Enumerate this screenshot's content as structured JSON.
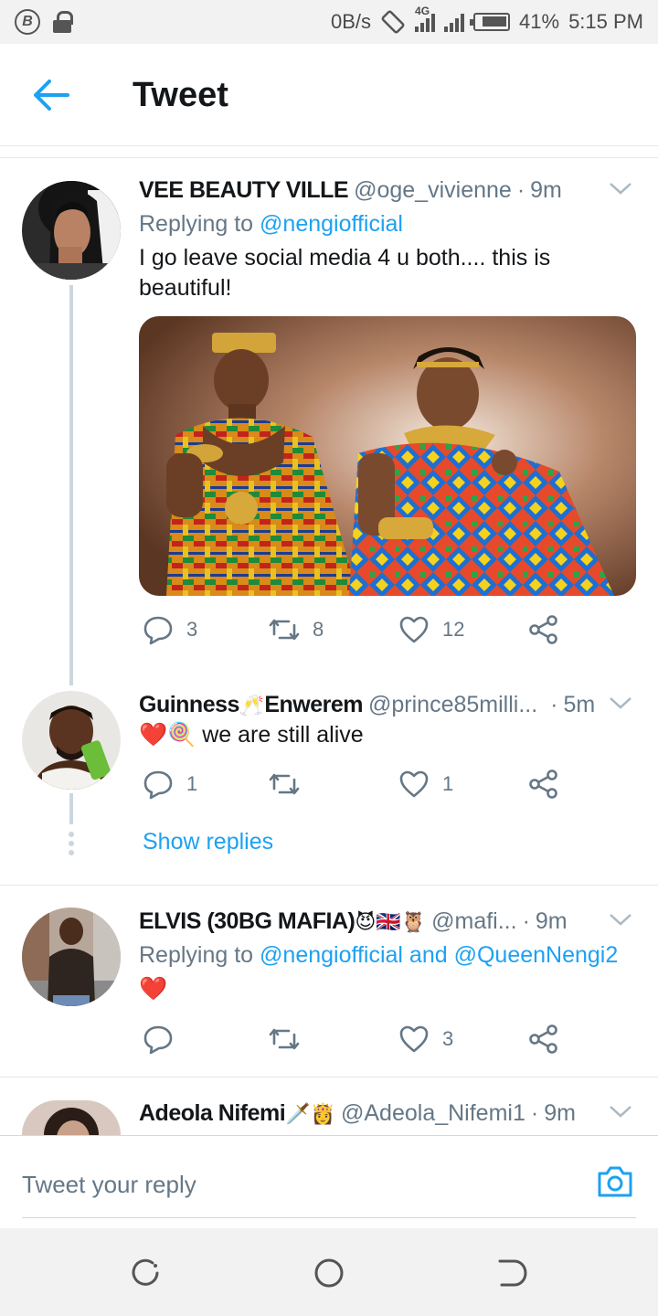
{
  "status_bar": {
    "net_speed": "0B/s",
    "network": "4G",
    "battery": "41%",
    "time": "5:15 PM",
    "icons": [
      "b-circle-icon",
      "lock-icon",
      "rotate-icon",
      "signal-icon",
      "battery-icon"
    ]
  },
  "header": {
    "title": "Tweet",
    "back_icon": "back-arrow-icon"
  },
  "tweets": [
    {
      "name": "VEE BEAUTY VILLE",
      "handle": "@oge_vivienne",
      "time": "9m",
      "replying_prefix": "Replying to ",
      "replying_to": "@nengiofficial",
      "text": "I go leave social media 4 u both.... this is beautiful!",
      "replies": "3",
      "retweets": "8",
      "likes": "12"
    },
    {
      "name": "Guinness",
      "name_suffix": "Enwerem",
      "name_emoji": "🥂",
      "handle": "@prince85milli...",
      "time": "5m",
      "text_emoji": "❤️🍭",
      "text": " we are still alive",
      "replies": "1",
      "retweets": "",
      "likes": "1",
      "show_replies": "Show replies"
    },
    {
      "name": "ELVIS (30BG MAFIA)",
      "name_emoji": " 😈🇬🇧🦉",
      "handle": "@mafi...",
      "time": "9m",
      "replying_prefix": "Replying to ",
      "replying_to": "@nengiofficial and @QueenNengi2",
      "text": "❤️",
      "replies": "",
      "retweets": "",
      "likes": "3"
    },
    {
      "name": "Adeola Nifemi",
      "name_emoji": " 🗡️👸",
      "handle": "@Adeola_Nifemi1",
      "time": "9m"
    }
  ],
  "composer": {
    "placeholder": "Tweet your reply",
    "camera_icon": "camera-icon"
  },
  "nav": [
    "recents-icon",
    "home-icon",
    "back-icon"
  ],
  "colors": {
    "accent": "#1da1f2",
    "secondary_text": "#657786",
    "divider": "#e1e8ed"
  }
}
